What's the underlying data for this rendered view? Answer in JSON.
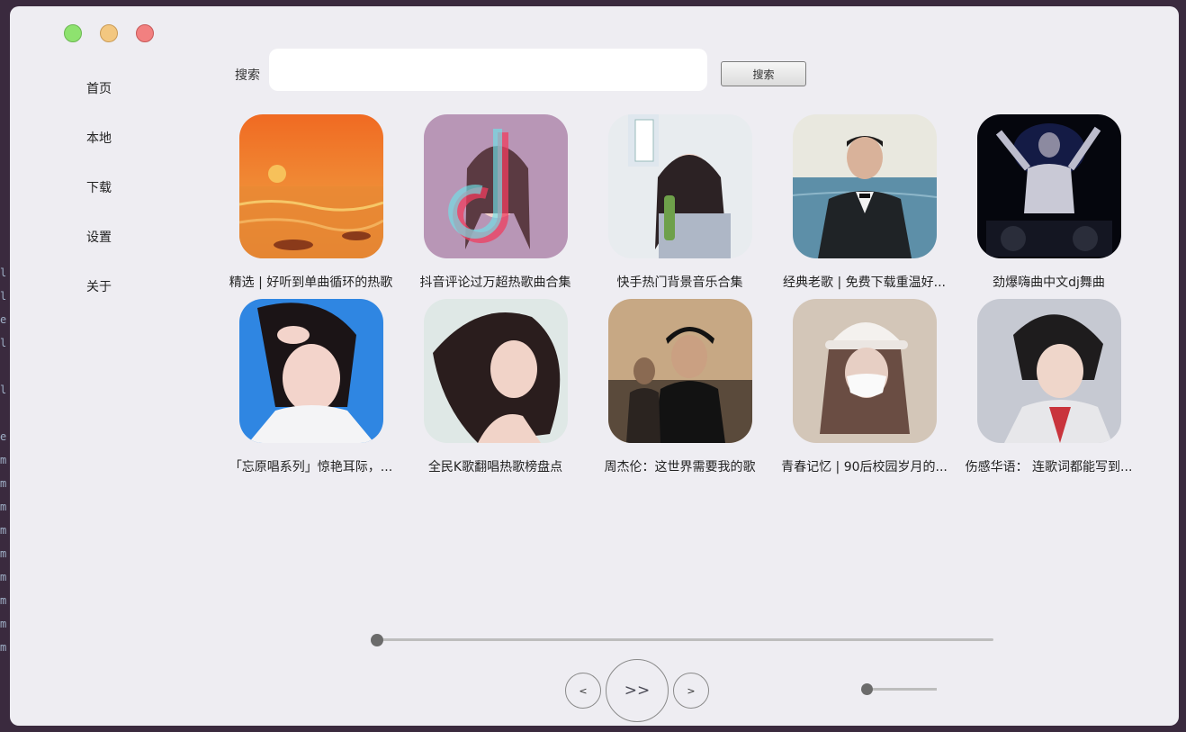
{
  "app": {
    "nav": [
      {
        "label": "首页"
      },
      {
        "label": "本地"
      },
      {
        "label": "下载"
      },
      {
        "label": "设置"
      },
      {
        "label": "关于"
      }
    ]
  },
  "search": {
    "label": "搜索",
    "value": "",
    "button_label": "搜索"
  },
  "playlists": [
    {
      "title": "精选 | 好听到单曲循环的热歌",
      "cover_icon": "sunset-sea-icon"
    },
    {
      "title": "抖音评论过万超热歌曲合集",
      "cover_icon": "tiktok-girl-icon"
    },
    {
      "title": "快手热门背景音乐合集",
      "cover_icon": "girl-drink-icon"
    },
    {
      "title": "经典老歌 | 免费下载重温好...",
      "cover_icon": "man-suit-sea-icon"
    },
    {
      "title": "劲爆嗨曲中文dj舞曲",
      "cover_icon": "dj-icon"
    },
    {
      "title": "「忘原唱系列」惊艳耳际，...",
      "cover_icon": "girl-blue-icon"
    },
    {
      "title": "全民K歌翻唱热歌榜盘点",
      "cover_icon": "illustrated-girl-icon"
    },
    {
      "title": "周杰伦：这世界需要我的歌",
      "cover_icon": "singer-cap-icon"
    },
    {
      "title": "青春记忆 | 90后校园岁月的...",
      "cover_icon": "girl-mask-icon"
    },
    {
      "title": "伤感华语： 连歌词都能写到...",
      "cover_icon": "boy-portrait-icon"
    }
  ],
  "player": {
    "progress": 0.0,
    "volume": 0.0,
    "prev_label": "<",
    "play_label": ">>",
    "next_label": ">"
  },
  "colors": {
    "window_bg": "#eeedf2",
    "close": "#f28080",
    "minimize": "#f3c780",
    "maximize": "#8ee26f"
  }
}
